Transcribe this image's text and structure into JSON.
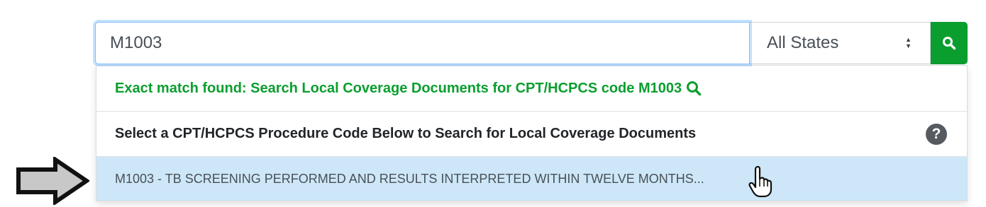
{
  "search": {
    "value": "M1003",
    "placeholder": ""
  },
  "state_select": {
    "selected": "All States"
  },
  "icons": {
    "search_button": "search-icon",
    "exact_match": "magnifier-icon",
    "help": "question-circle-icon",
    "pointer_arrow": "right-arrow-icon",
    "cursor": "hand-pointer-icon"
  },
  "dropdown": {
    "exact_match_text": "Exact match found: Search Local Coverage Documents for CPT/HCPCS code M1003",
    "header_text": "Select a CPT/HCPCS Procedure Code Below to Search for Local Coverage Documents",
    "help_glyph": "?",
    "results": [
      {
        "label": "M1003 - TB SCREENING PERFORMED AND RESULTS INTERPRETED WITHIN TWELVE MONTHS..."
      }
    ]
  },
  "colors": {
    "accent_green": "#0a9e2f",
    "highlight_row": "#cde7f8",
    "focus_border": "#80bdff"
  }
}
